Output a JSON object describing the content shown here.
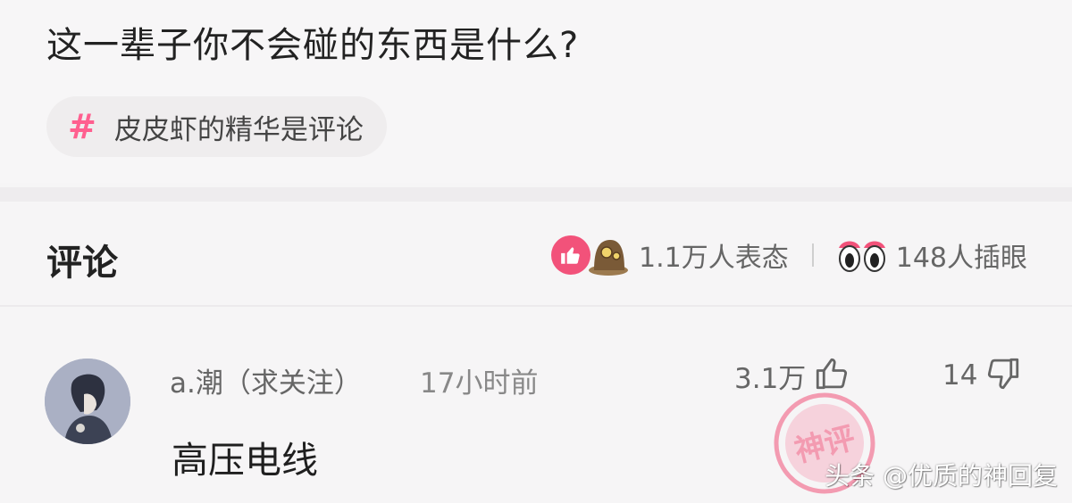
{
  "question": {
    "title": "这一辈子你不会碰的东西是什么?",
    "topic_icon": "#",
    "topic": "皮皮虾的精华是评论"
  },
  "comments_header": {
    "title": "评论",
    "reactions": "1.1万人表态",
    "peeks": "148人插眼"
  },
  "comment": {
    "username": "a.潮（求关注）",
    "time": "17小时前",
    "likes": "3.1万",
    "dislikes": "14",
    "text": "高压电线",
    "badge": "神评"
  },
  "watermark": "头条 @优质的神回复",
  "colors": {
    "accent": "#f2527a",
    "hash": "#ff5f8f"
  }
}
